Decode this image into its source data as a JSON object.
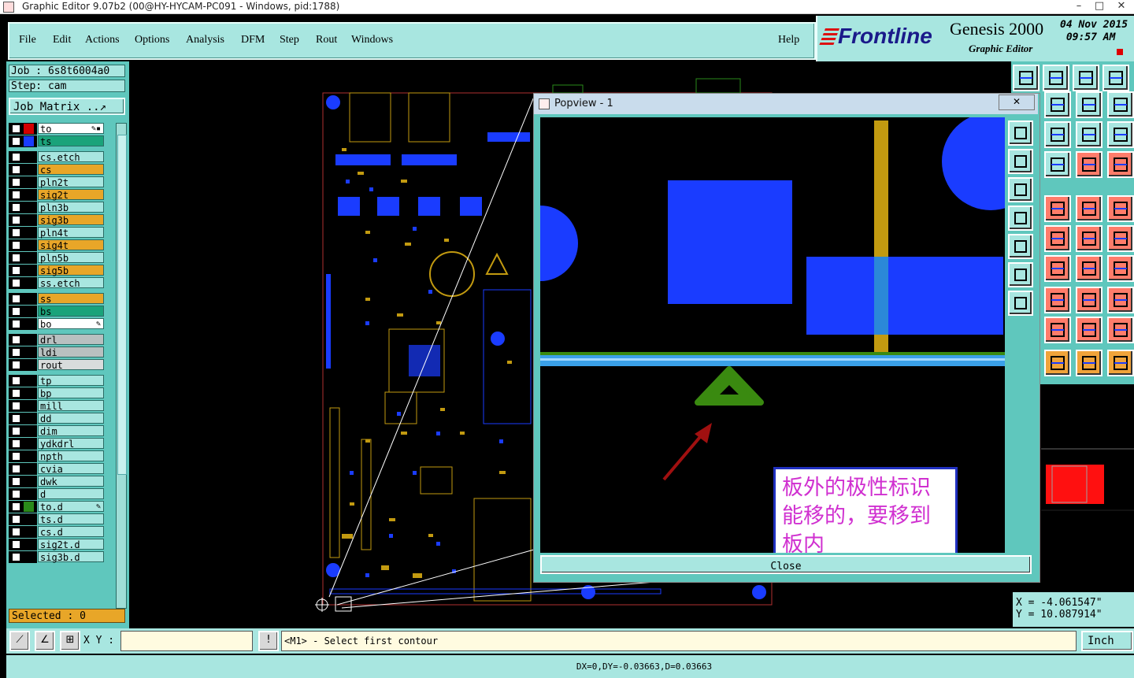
{
  "window": {
    "title": "Graphic Editor 9.07b2 (00@HY-HYCAM-PC091 - Windows, pid:1788)",
    "controls": [
      "–",
      "□",
      "✕"
    ]
  },
  "menu": {
    "items": [
      "File",
      "Edit",
      "Actions",
      "Options",
      "Analysis",
      "DFM",
      "Step",
      "Rout",
      "Windows"
    ],
    "help": "Help"
  },
  "branding": {
    "logo": "Frontline",
    "product": "Genesis 2000",
    "subtitle": "Graphic Editor",
    "date": "04 Nov 2015",
    "time": "09:57 AM"
  },
  "job": {
    "job_label": "Job : 6s8t6004a0",
    "step_label": "Step: cam",
    "matrix_button": "Job Matrix ..↗"
  },
  "layers": [
    {
      "name": "to",
      "color": "#ffffff",
      "marker": "#d40000",
      "icon": "✎▪"
    },
    {
      "name": "ts",
      "color": "#1aa37a",
      "marker": "#1a3cff",
      "icon": ""
    },
    {
      "name": "cs.etch",
      "color": "#a8e6e0",
      "marker": "",
      "icon": ""
    },
    {
      "name": "cs",
      "color": "#e8a628",
      "marker": "",
      "icon": ""
    },
    {
      "name": "pln2t",
      "color": "#a8e6e0",
      "marker": "",
      "icon": ""
    },
    {
      "name": "sig2t",
      "color": "#e8a628",
      "marker": "",
      "icon": ""
    },
    {
      "name": "pln3b",
      "color": "#a8e6e0",
      "marker": "",
      "icon": ""
    },
    {
      "name": "sig3b",
      "color": "#e8a628",
      "marker": "",
      "icon": ""
    },
    {
      "name": "pln4t",
      "color": "#a8e6e0",
      "marker": "",
      "icon": ""
    },
    {
      "name": "sig4t",
      "color": "#e8a628",
      "marker": "",
      "icon": ""
    },
    {
      "name": "pln5b",
      "color": "#a8e6e0",
      "marker": "",
      "icon": ""
    },
    {
      "name": "sig5b",
      "color": "#e8a628",
      "marker": "",
      "icon": ""
    },
    {
      "name": "ss.etch",
      "color": "#a8e6e0",
      "marker": "",
      "icon": ""
    },
    {
      "name": "ss",
      "color": "#e8a628",
      "marker": "",
      "icon": ""
    },
    {
      "name": "bs",
      "color": "#1aa37a",
      "marker": "",
      "icon": ""
    },
    {
      "name": "bo",
      "color": "#ffffff",
      "marker": "",
      "icon": "✎"
    },
    {
      "name": "drl",
      "color": "#b8c0c0",
      "marker": "",
      "icon": ""
    },
    {
      "name": "ldi",
      "color": "#b8c0c0",
      "marker": "",
      "icon": ""
    },
    {
      "name": "rout",
      "color": "#d8dcdc",
      "marker": "",
      "icon": ""
    },
    {
      "name": "tp",
      "color": "#a8e6e0",
      "marker": "",
      "icon": ""
    },
    {
      "name": "bp",
      "color": "#a8e6e0",
      "marker": "",
      "icon": ""
    },
    {
      "name": "mill",
      "color": "#a8e6e0",
      "marker": "",
      "icon": ""
    },
    {
      "name": "dd",
      "color": "#a8e6e0",
      "marker": "",
      "icon": ""
    },
    {
      "name": "dim",
      "color": "#a8e6e0",
      "marker": "",
      "icon": ""
    },
    {
      "name": "ydkdrl",
      "color": "#a8e6e0",
      "marker": "",
      "icon": ""
    },
    {
      "name": "npth",
      "color": "#a8e6e0",
      "marker": "",
      "icon": ""
    },
    {
      "name": "cvia",
      "color": "#a8e6e0",
      "marker": "",
      "icon": ""
    },
    {
      "name": "dwk",
      "color": "#a8e6e0",
      "marker": "",
      "icon": ""
    },
    {
      "name": "d",
      "color": "#a8e6e0",
      "marker": "",
      "icon": ""
    },
    {
      "name": "to.d",
      "color": "#a8e6e0",
      "marker": "#2a8a1a",
      "icon": "✎"
    },
    {
      "name": "ts.d",
      "color": "#a8e6e0",
      "marker": "",
      "icon": ""
    },
    {
      "name": "cs.d",
      "color": "#a8e6e0",
      "marker": "",
      "icon": ""
    },
    {
      "name": "sig2t.d",
      "color": "#a8e6e0",
      "marker": "",
      "icon": ""
    },
    {
      "name": "sig3b.d",
      "color": "#a8e6e0",
      "marker": "",
      "icon": ""
    }
  ],
  "selected": "Selected : 0",
  "command": {
    "xy_label": "X Y :",
    "xy_value": "",
    "message": "<M1> - Select first contour",
    "unit": "Inch"
  },
  "status": "DX=0,DY=-0.03663,D=0.03663",
  "coords": {
    "x": "X = -4.061547\"",
    "y": "Y = 10.087914\""
  },
  "popview": {
    "title": "Popview - 1",
    "close_x": "✕",
    "close_button": "Close",
    "annotation": "板外的极性标识能移的，要移到板内"
  },
  "colors": {
    "panel": "#5fc7bd",
    "panel_light": "#a8e6e0",
    "pcb_blue": "#1a3cff",
    "pcb_gold": "#c29a10",
    "polarity_green": "#3a8a10",
    "arrow_red": "#a01010"
  }
}
